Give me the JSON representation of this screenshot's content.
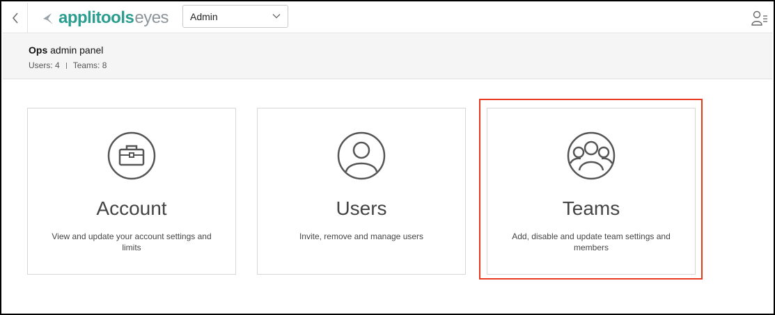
{
  "topbar": {
    "logo_part1": "applitools",
    "logo_part2": "eyes",
    "select_value": "Admin"
  },
  "subheader": {
    "title_bold": "Ops",
    "title_rest": " admin panel",
    "users_stat": "Users: 4",
    "teams_stat": "Teams: 8"
  },
  "cards": [
    {
      "title": "Account",
      "desc": "View and update your account settings and limits",
      "icon": "briefcase-icon"
    },
    {
      "title": "Users",
      "desc": "Invite, remove and manage users",
      "icon": "user-icon"
    },
    {
      "title": "Teams",
      "desc": "Add, disable and update team settings and members",
      "icon": "team-icon"
    }
  ],
  "colors": {
    "brand_teal": "#2a9d8f",
    "brand_gray": "#8d959c",
    "highlight_red": "#e8391f"
  }
}
